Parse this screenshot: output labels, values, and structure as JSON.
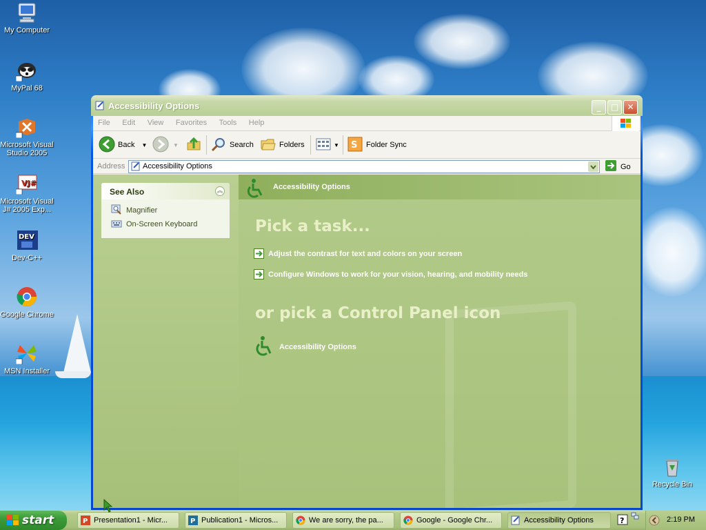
{
  "desktop": {
    "icons": [
      {
        "label": "My Computer"
      },
      {
        "label": "MyPal 68"
      },
      {
        "label": "Microsoft Visual Studio 2005"
      },
      {
        "label": "Microsoft Visual J# 2005 Exp..."
      },
      {
        "label": "Dev-C++"
      },
      {
        "label": "Google Chrome"
      },
      {
        "label": "MSN Installer"
      },
      {
        "label": "Recycle Bin"
      }
    ]
  },
  "window": {
    "title": "Accessibility Options",
    "menu": [
      "File",
      "Edit",
      "View",
      "Favorites",
      "Tools",
      "Help"
    ],
    "toolbar": {
      "back_label": "Back",
      "search_label": "Search",
      "folders_label": "Folders",
      "foldersync_label": "Folder Sync"
    },
    "address": {
      "label": "Address",
      "value": "Accessibility Options",
      "go_label": "Go"
    },
    "see_also": {
      "title": "See Also",
      "links": [
        "Magnifier",
        "On-Screen Keyboard"
      ]
    },
    "main": {
      "header": "Accessibility Options",
      "pick_task": "Pick a task...",
      "tasks": [
        "Adjust the contrast for text and colors on your screen",
        "Configure Windows to work for your vision, hearing, and mobility needs"
      ],
      "pick_icon": "or pick a Control Panel icon",
      "icon_label": "Accessibility Options"
    }
  },
  "taskbar": {
    "start_label": "start",
    "tasks": [
      "Presentation1 - Micr...",
      "Publication1 - Micros...",
      "We are sorry, the pa...",
      "Google - Google Chr...",
      "Accessibility Options"
    ],
    "clock": "2:19 PM"
  },
  "colors": {
    "theme_green": "#aec786",
    "start_green": "#3c9a38"
  }
}
